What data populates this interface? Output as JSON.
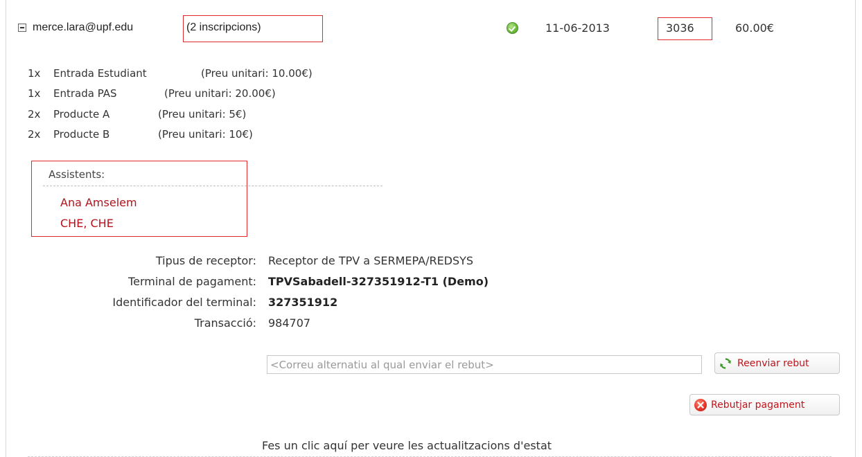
{
  "header": {
    "email": "merce.lara@upf.edu",
    "inscriptions": "(2 inscripcions)",
    "status_icon": "check-circle-icon",
    "date": "11-06-2013",
    "number": "3036",
    "total": "60.00€"
  },
  "items": [
    {
      "qty": "1x",
      "name": "Entrada Estudiant",
      "price": "(Preu unitari: 10.00€)"
    },
    {
      "qty": "1x",
      "name": "Entrada PAS",
      "price": "(Preu unitari: 20.00€)"
    },
    {
      "qty": "2x",
      "name": "Producte A",
      "price": "(Preu unitari: 5€)"
    },
    {
      "qty": "2x",
      "name": "Producte B",
      "price": "(Preu unitari: 10€)"
    }
  ],
  "assistants": {
    "label": "Assistents:",
    "names": [
      "Ana Amselem",
      "CHE, CHE"
    ]
  },
  "details": [
    {
      "label": "Tipus de receptor:",
      "value": "Receptor de TPV a SERMEPA/REDSYS",
      "bold": false
    },
    {
      "label": "Terminal de pagament:",
      "value": "TPVSabadell-327351912-T1 (Demo)",
      "bold": true
    },
    {
      "label": "Identificador del terminal:",
      "value": "327351912",
      "bold": true
    },
    {
      "label": "Transacció:",
      "value": "984707",
      "bold": false
    }
  ],
  "resend": {
    "placeholder": "<Correu alternatiu al qual enviar el rebut>",
    "button_label": "Reenviar rebut",
    "icon": "refresh-icon"
  },
  "reject": {
    "button_label": "Rebutjar pagament",
    "icon": "reject-icon"
  },
  "status_link": "Fes un clic aquí per veure les actualitzacions d'estat",
  "colors": {
    "highlight_border": "#e0282e",
    "attendee_text": "#b5121b",
    "button_text": "#c0141c"
  }
}
